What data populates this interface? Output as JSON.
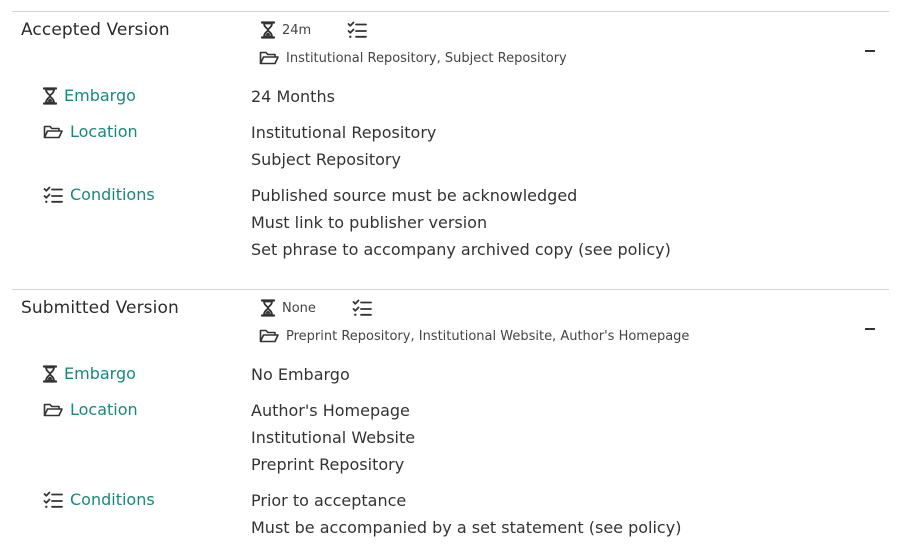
{
  "accepted": {
    "title": "Accepted Version",
    "summary_embargo": "24m",
    "summary_locations": "Institutional Repository, Subject Repository",
    "collapse_symbol": "−",
    "embargo_label": "Embargo",
    "embargo_value": "24 Months",
    "location_label": "Location",
    "locations": [
      "Institutional Repository",
      "Subject Repository"
    ],
    "conditions_label": "Conditions",
    "conditions": [
      "Published source must be acknowledged",
      "Must link to publisher version",
      "Set phrase to accompany archived copy (see policy)"
    ]
  },
  "submitted": {
    "title": "Submitted Version",
    "summary_embargo": "None",
    "summary_locations": "Preprint Repository, Institutional Website, Author's Homepage",
    "collapse_symbol": "−",
    "embargo_label": "Embargo",
    "embargo_value": "No Embargo",
    "location_label": "Location",
    "locations": [
      "Author's Homepage",
      "Institutional Website",
      "Preprint Repository"
    ],
    "conditions_label": "Conditions",
    "conditions": [
      "Prior to acceptance",
      "Must be accompanied by a set statement (see policy)"
    ]
  },
  "colors": {
    "accent": "#17897c",
    "text": "#333333",
    "divider": "#d4d4d4"
  },
  "icons": [
    "hourglass-icon",
    "checklist-icon",
    "folder-open-icon"
  ]
}
